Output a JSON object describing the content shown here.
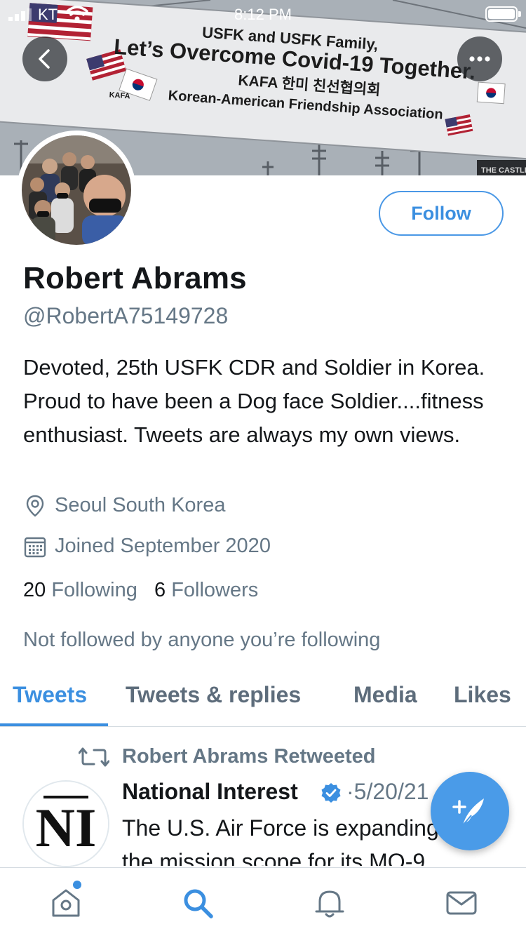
{
  "status_bar": {
    "carrier": "KT",
    "time": "8:12 PM"
  },
  "banner": {
    "line1": "USFK and USFK Family,",
    "line2": "Let’s Overcome Covid-19 Together.",
    "line3": "KAFA 한미 친선협의회",
    "line4": "Korean-American Friendship Association",
    "logo_text": "KAFA",
    "corner_text": "THE CASTLE"
  },
  "profile": {
    "follow_label": "Follow",
    "name": "Robert Abrams",
    "handle": "@RobertA75149728",
    "bio": "Devoted, 25th USFK CDR and Soldier in Korea. Proud to have been a Dog face Soldier....fitness enthusiast. Tweets are always my own views.",
    "location": "Seoul South Korea",
    "joined": "Joined September 2020",
    "following_count": "20",
    "following_label": "Following",
    "followers_count": "6",
    "followers_label": "Followers",
    "not_followed": "Not followed by anyone you’re following"
  },
  "tabs": [
    {
      "label": "Tweets",
      "active": true
    },
    {
      "label": "Tweets & replies",
      "active": false
    },
    {
      "label": "Media",
      "active": false
    },
    {
      "label": "Likes",
      "active": false
    }
  ],
  "tweet": {
    "retweet_label": "Robert Abrams Retweeted",
    "author": "National Interest",
    "date": "·5/20/21",
    "body_line1": "The U.S. Air Force is expanding",
    "body_line2": "the mission scope for its MQ-9",
    "avatar_text": "NI"
  },
  "icons": {
    "back": "chevron-left-icon",
    "more": "ellipsis-icon",
    "location": "map-pin-icon",
    "calendar": "calendar-icon",
    "retweet": "retweet-icon",
    "verified": "verified-badge-icon",
    "compose": "compose-tweet-icon",
    "home": "home-icon",
    "search": "search-icon",
    "notifications": "bell-icon",
    "messages": "mail-icon"
  },
  "colors": {
    "accent": "#3b8fe0",
    "secondary_text": "#657786",
    "primary_text": "#14171a",
    "fab": "#4a9be8"
  }
}
